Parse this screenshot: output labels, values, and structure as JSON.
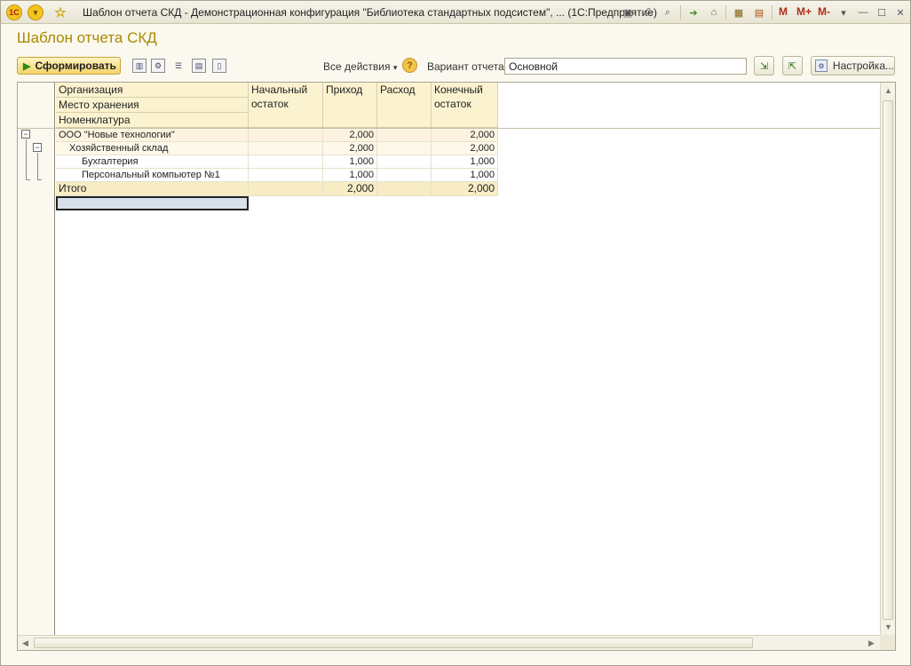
{
  "window": {
    "title": "Шаблон отчета СКД - Демонстрационная конфигурация \"Библиотека стандартных подсистем\", ...  (1С:Предприятие)",
    "app_icon": "1c-logo-icon",
    "menu_icon": "chevron-down-icon",
    "fav_icon": "star-icon",
    "toolbar_icons": [
      "save-icon",
      "print-icon",
      "print-preview-icon",
      "forward-icon",
      "bookmark-icon",
      "calculator-icon",
      "calendar-icon"
    ],
    "memory_labels": [
      "M",
      "M+",
      "M-"
    ],
    "window_controls": [
      "minimize",
      "restore",
      "close"
    ]
  },
  "form": {
    "title": "Шаблон отчета СКД",
    "generate_button": "Сформировать",
    "all_actions": "Все действия",
    "variant_label": "Вариант отчета:",
    "variant_value": "Основной",
    "settings_button": "Настройка..."
  },
  "report": {
    "grouping_headers": [
      "Организация",
      "Место хранения",
      "Номенклатура"
    ],
    "column_headers": {
      "opening_balance": "Начальный остаток",
      "receipt": "Приход",
      "expense": "Расход",
      "closing_balance": "Конечный остаток"
    },
    "rows": [
      {
        "name": "ООО \"Новые технологии\"",
        "opening": "",
        "receipt": "2,000",
        "expense": "",
        "closing": "2,000"
      },
      {
        "name": "Хозяйственный склад",
        "opening": "",
        "receipt": "2,000",
        "expense": "",
        "closing": "2,000"
      },
      {
        "name": "Бухгалтерия",
        "opening": "",
        "receipt": "1,000",
        "expense": "",
        "closing": "1,000"
      },
      {
        "name": "Персональный компьютер №1",
        "opening": "",
        "receipt": "1,000",
        "expense": "",
        "closing": "1,000"
      }
    ],
    "total": {
      "label": "Итого",
      "opening": "",
      "receipt": "2,000",
      "expense": "",
      "closing": "2,000"
    }
  },
  "colors": {
    "title_accent": "#a88a00",
    "header_fill": "#fbf3d0",
    "total_fill": "#f7ecc4"
  }
}
